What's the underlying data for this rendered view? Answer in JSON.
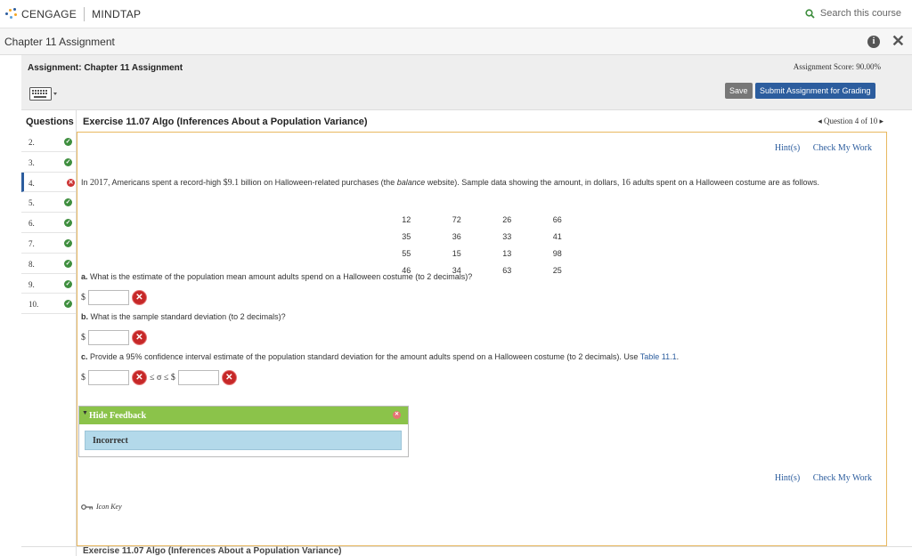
{
  "topbar": {
    "brand": "CENGAGE",
    "product": "MINDTAP",
    "search_label": "Search this course"
  },
  "chapter_bar": {
    "title": "Chapter 11 Assignment"
  },
  "assignment": {
    "title": "Assignment: Chapter 11 Assignment",
    "score": "Assignment Score: 90.00%",
    "save_label": "Save",
    "submit_label": "Submit Assignment for Grading"
  },
  "questions_header": "Questions",
  "exercise_title": "Exercise 11.07 Algo (Inferences About a Population Variance)",
  "question_nav": "◂ Question 4 of 10 ▸",
  "question_list": [
    {
      "num": "2.",
      "status": "correct"
    },
    {
      "num": "3.",
      "status": "correct"
    },
    {
      "num": "4.",
      "status": "incorrect"
    },
    {
      "num": "5.",
      "status": "correct"
    },
    {
      "num": "6.",
      "status": "correct"
    },
    {
      "num": "7.",
      "status": "correct"
    },
    {
      "num": "8.",
      "status": "correct"
    },
    {
      "num": "9.",
      "status": "correct"
    },
    {
      "num": "10.",
      "status": "correct"
    }
  ],
  "hints": {
    "hint_label": "Hint(s)",
    "check_label": "Check My Work"
  },
  "question": {
    "intro_1": "In ",
    "year": "2017",
    "intro_2": ", Americans spent a record-high ",
    "amount": "$9.1",
    "intro_3": " billion on Halloween-related purchases (the ",
    "source": "balance",
    "intro_4": " website). Sample data showing the amount, in dollars, ",
    "n": "16",
    "intro_5": " adults spent on a Halloween costume are as follows."
  },
  "data_rows": [
    [
      "12",
      "72",
      "26",
      "66"
    ],
    [
      "35",
      "36",
      "33",
      "41"
    ],
    [
      "55",
      "15",
      "13",
      "98"
    ],
    [
      "46",
      "34",
      "63",
      "25"
    ]
  ],
  "part_a": {
    "label_1": "a.",
    "label_2": " What is the estimate of the population mean amount adults spend on a Halloween costume (to ",
    "decimals": "2",
    "label_3": " decimals)?",
    "currency": "$",
    "value": ""
  },
  "part_b": {
    "label_1": "b.",
    "label_2": " What is the sample standard deviation (to ",
    "decimals": "2",
    "label_3": " decimals)?",
    "currency": "$",
    "value": ""
  },
  "part_c": {
    "label_1": "c.",
    "label_2": " Provide a ",
    "confidence": "95%",
    "label_3": " confidence interval estimate of the population standard deviation for the amount adults spend on a Halloween costume (to ",
    "decimals": "2",
    "label_4": " decimals). Use ",
    "table_link": "Table 11.1",
    "label_5": ".",
    "currency": "$",
    "between": "≤ σ ≤ $",
    "value_low": "",
    "value_high": ""
  },
  "feedback": {
    "toggle_label": "Hide Feedback",
    "message": "Incorrect"
  },
  "icon_key_label": "Icon Key",
  "bottom_exercise_title": "Exercise 11.07 Algo (Inferences About a Population Variance)",
  "colors": {
    "correct": "#3e8e3e",
    "incorrect": "#c62828",
    "accent": "#2c5d9e",
    "feedback_header": "#8bc34a",
    "panel_border": "#e8b860"
  }
}
